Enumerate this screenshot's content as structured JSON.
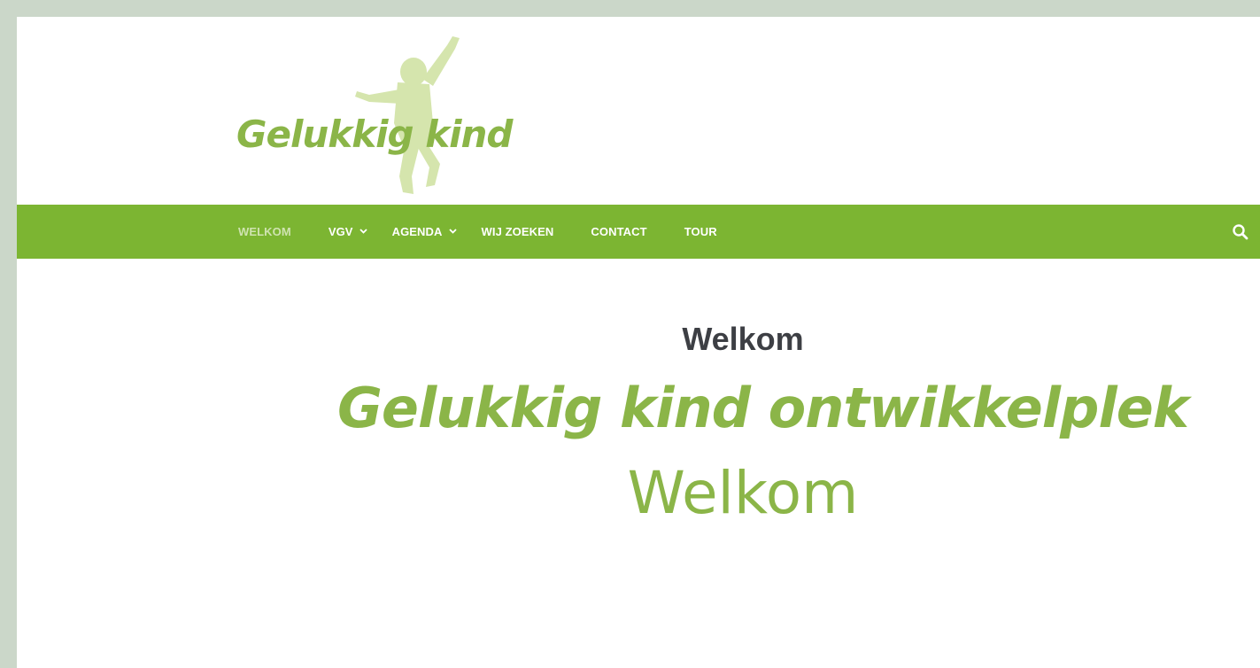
{
  "site": {
    "logo_text": "Gelukkig kind"
  },
  "nav": {
    "items": [
      {
        "label": "WELKOM",
        "active": true,
        "has_submenu": false
      },
      {
        "label": "VGV",
        "active": false,
        "has_submenu": true
      },
      {
        "label": "AGENDA",
        "active": false,
        "has_submenu": true
      },
      {
        "label": "WIJ ZOEKEN",
        "active": false,
        "has_submenu": false
      },
      {
        "label": "CONTACT",
        "active": false,
        "has_submenu": false
      },
      {
        "label": "TOUR",
        "active": false,
        "has_submenu": false
      }
    ],
    "submenu_icon": "chevron-down-icon",
    "search_icon": "search-icon"
  },
  "content": {
    "page_title": "Welkom",
    "hero_title": "Gelukkig kind ontwikkelplek",
    "hero_subtitle": "Welkom"
  },
  "colors": {
    "outer_background": "#cbd7c9",
    "nav_background": "#7cb532",
    "nav_active_text": "#cfe3b0",
    "brand_green": "#8bb548",
    "logo_silhouette": "#d5e5ad",
    "title_text": "#3d3f44"
  }
}
